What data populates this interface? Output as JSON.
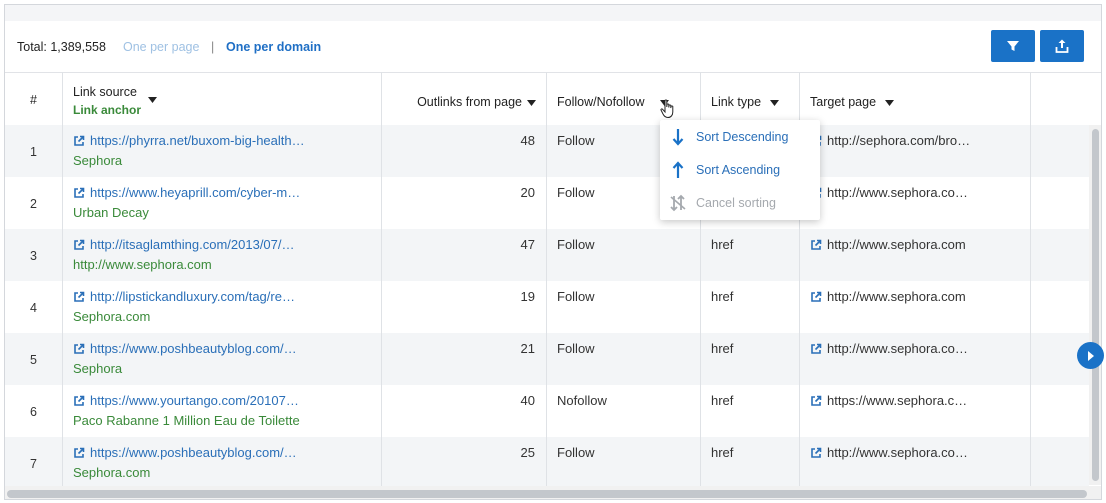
{
  "toolbar": {
    "total_label": "Total: 1,389,558",
    "view_one_per_page": "One per page",
    "separator": "|",
    "view_one_per_domain": "One per domain",
    "filter_icon": "filter-icon",
    "export_icon": "export-icon"
  },
  "columns": {
    "index": "#",
    "link_source": "Link source",
    "link_anchor": "Link anchor",
    "outlinks": "Outlinks from page",
    "follow": "Follow/Nofollow",
    "link_type": "Link type",
    "target_page": "Target page"
  },
  "rows": [
    {
      "num": "1",
      "source": "https://phyrra.net/buxom-big-health…",
      "anchor": "Sephora",
      "outlinks": "48",
      "follow": "Follow",
      "link_type": "",
      "target": "http://sephora.com/bro…"
    },
    {
      "num": "2",
      "source": "https://www.heyaprill.com/cyber-m…",
      "anchor": "Urban Decay",
      "outlinks": "20",
      "follow": "Follow",
      "link_type": "",
      "target": "http://www.sephora.co…"
    },
    {
      "num": "3",
      "source": "http://itsaglamthing.com/2013/07/…",
      "anchor": "http://www.sephora.com",
      "outlinks": "47",
      "follow": "Follow",
      "link_type": "href",
      "target": "http://www.sephora.com"
    },
    {
      "num": "4",
      "source": "http://lipstickandluxury.com/tag/re…",
      "anchor": "Sephora.com",
      "outlinks": "19",
      "follow": "Follow",
      "link_type": "href",
      "target": "http://www.sephora.com"
    },
    {
      "num": "5",
      "source": "https://www.poshbeautyblog.com/…",
      "anchor": "Sephora",
      "outlinks": "21",
      "follow": "Follow",
      "link_type": "href",
      "target": "http://www.sephora.co…"
    },
    {
      "num": "6",
      "source": "https://www.yourtango.com/20107…",
      "anchor": "Paco Rabanne 1 Million Eau de Toilette",
      "outlinks": "40",
      "follow": "Nofollow",
      "link_type": "href",
      "target": "https://www.sephora.c…"
    },
    {
      "num": "7",
      "source": "https://www.poshbeautyblog.com/…",
      "anchor": "Sephora.com",
      "outlinks": "25",
      "follow": "Follow",
      "link_type": "href",
      "target": "http://www.sephora.co…"
    }
  ],
  "sort_menu": {
    "descending": "Sort Descending",
    "ascending": "Sort Ascending",
    "cancel": "Cancel sorting"
  },
  "colors": {
    "accent": "#1a72c7",
    "link": "#2a6fb8",
    "anchor": "#3a8a3a",
    "disabled": "#a5a9ae"
  }
}
